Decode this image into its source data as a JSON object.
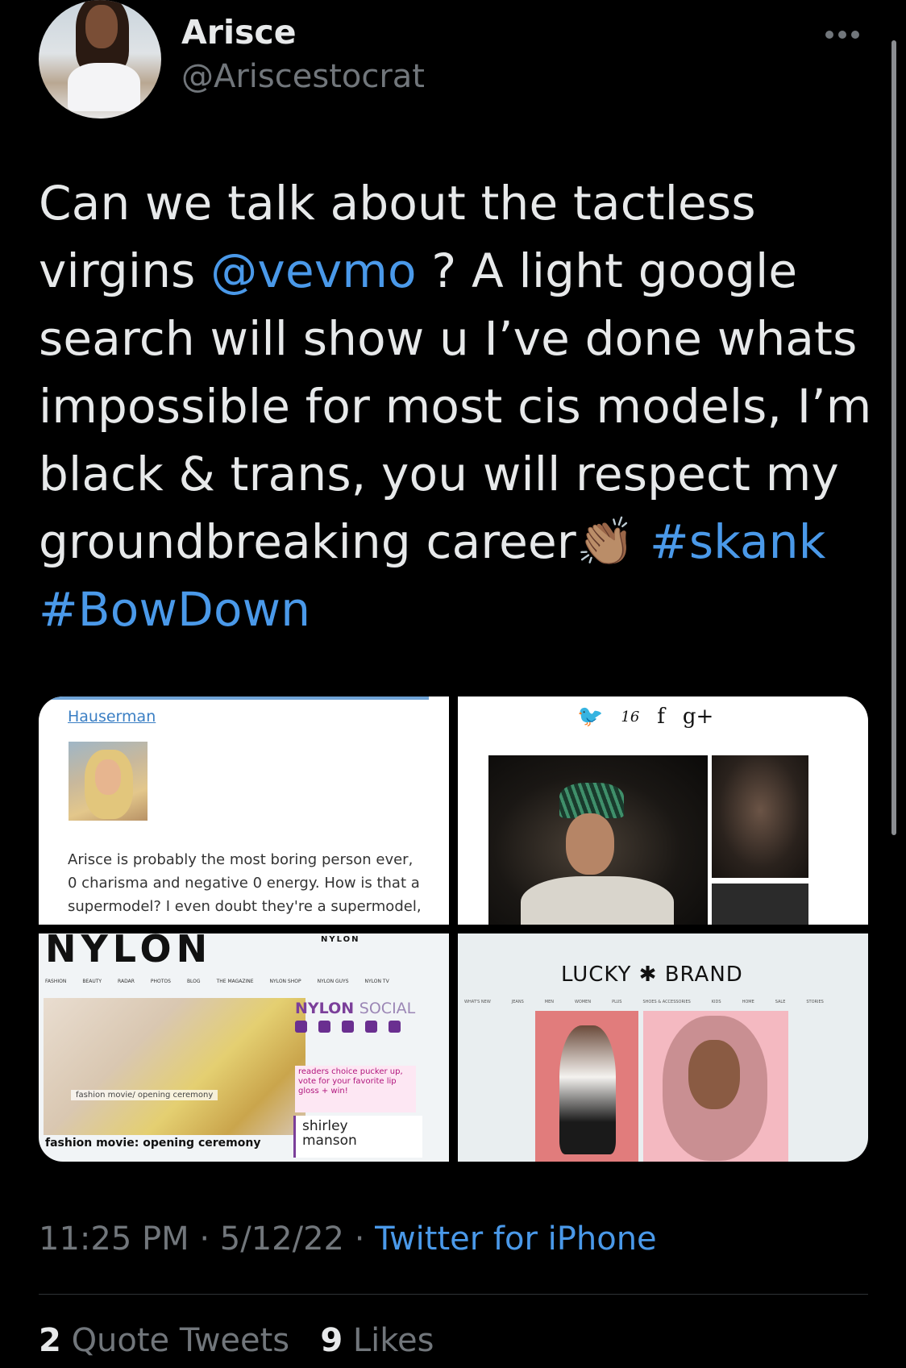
{
  "author": {
    "display_name": "Arisce",
    "handle": "@Ariscestocrat"
  },
  "tweet": {
    "text_part1": "Can we talk about the tactless virgins ",
    "mention": "@vevmo",
    "text_part2": " ? A light google search will show u I’ve done whats impossible for most cis models, I’m black & trans, you will respect my groundbreaking career",
    "emoji": "👏🏽",
    "hashtag1": "#skank",
    "hashtag2": "#BowDown"
  },
  "media": {
    "tile1": {
      "username": "Hauserman",
      "comment": "Arisce is probably the most boring person ever, 0 charisma and negative 0 energy. How is that a supermodel? I even doubt they're a supermodel,"
    },
    "tile2": {
      "twitter_count": "16",
      "facebook_glyph": "f",
      "gplus_glyph": "g+"
    },
    "tile3": {
      "logo": "NYLON",
      "mini_logo": "NYLON",
      "nav": [
        "FASHION",
        "BEAUTY",
        "RADAR",
        "PHOTOS",
        "BLOG",
        "THE MAGAZINE",
        "NYLON SHOP",
        "NYLON GUYS",
        "NYLON TV"
      ],
      "social_title": "NYLON",
      "social_sub": "SOCIAL",
      "caption_small": "fashion movie/ opening ceremony",
      "caption_main": "fashion movie: opening ceremony",
      "promo": "readers choice pucker up, vote for your favorite lip gloss + win!",
      "feature_line1": "shirley",
      "feature_line2": "manson"
    },
    "tile4": {
      "logo": "LUCKY ✱ BRAND",
      "nav": [
        "WHAT'S NEW",
        "JEANS",
        "MEN",
        "WOMEN",
        "PLUS",
        "SHOES & ACCESSORIES",
        "KIDS",
        "HOME",
        "SALE",
        "STORIES"
      ]
    }
  },
  "meta": {
    "time": "11:25 PM",
    "date": "5/12/22",
    "separator": "·",
    "source": "Twitter for iPhone"
  },
  "stats": {
    "quote_count": "2",
    "quote_label": "Quote Tweets",
    "like_count": "9",
    "like_label": "Likes"
  },
  "colors": {
    "background": "#000000",
    "text": "#e7e9ea",
    "secondary": "#71767b",
    "link": "#4a99e9"
  },
  "icons": [
    "more-options-icon",
    "twitter-bird-icon",
    "facebook-icon",
    "google-plus-icon"
  ]
}
